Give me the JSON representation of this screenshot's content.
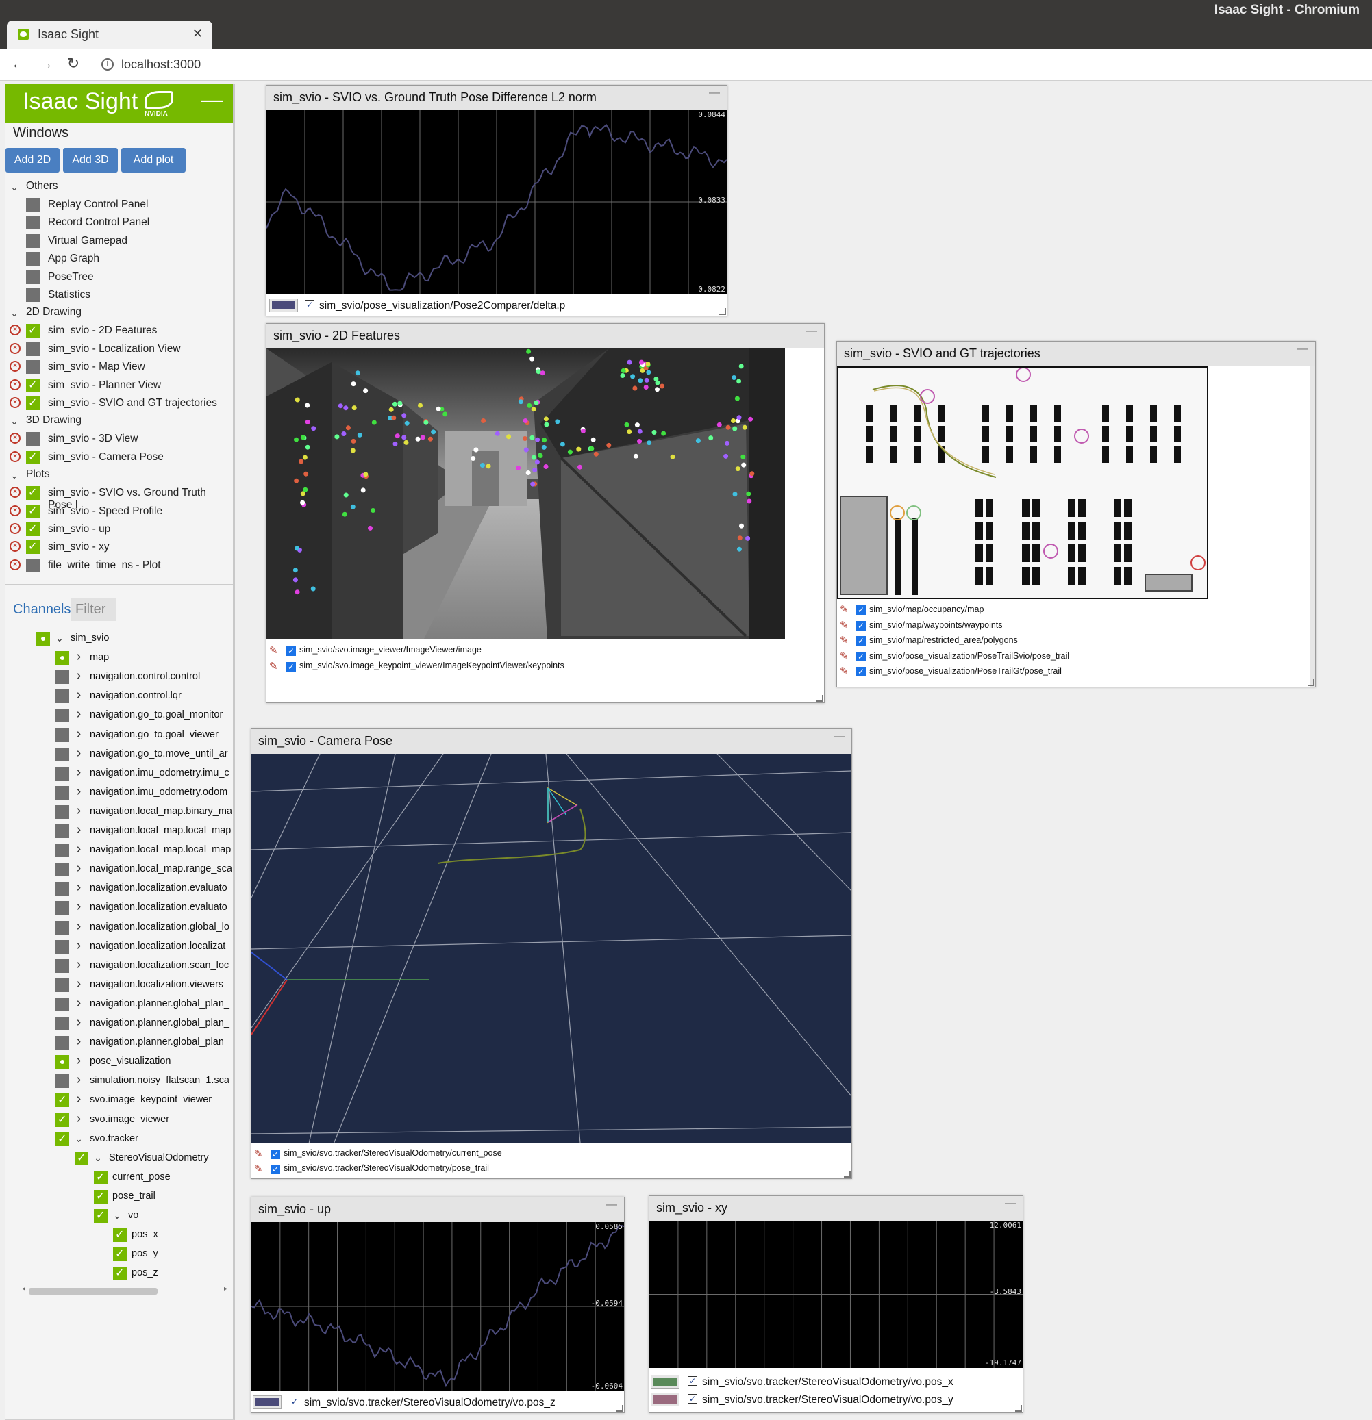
{
  "browser": {
    "window_title": "Isaac Sight - Chromium",
    "tab_title": "Isaac Sight",
    "url": "localhost:3000"
  },
  "sidebar": {
    "brand": "Isaac Sight",
    "nvidia": "NVIDIA",
    "windows_title": "Windows",
    "buttons": [
      "Add 2D",
      "Add 3D",
      "Add plot"
    ],
    "groups": [
      {
        "label": "Others",
        "items": [
          {
            "label": "Replay Control Panel",
            "checked": false,
            "removable": false
          },
          {
            "label": "Record Control Panel",
            "checked": false,
            "removable": false
          },
          {
            "label": "Virtual Gamepad",
            "checked": false,
            "removable": false
          },
          {
            "label": "App Graph",
            "checked": false,
            "removable": false
          },
          {
            "label": "PoseTree",
            "checked": false,
            "removable": false
          },
          {
            "label": "Statistics",
            "checked": false,
            "removable": false
          }
        ]
      },
      {
        "label": "2D Drawing",
        "items": [
          {
            "label": "sim_svio - 2D Features",
            "checked": true,
            "removable": true
          },
          {
            "label": "sim_svio - Localization View",
            "checked": false,
            "removable": true
          },
          {
            "label": "sim_svio - Map View",
            "checked": false,
            "removable": true
          },
          {
            "label": "sim_svio - Planner View",
            "checked": true,
            "removable": true
          },
          {
            "label": "sim_svio - SVIO and GT trajectories",
            "checked": true,
            "removable": true
          }
        ]
      },
      {
        "label": "3D Drawing",
        "items": [
          {
            "label": "sim_svio - 3D View",
            "checked": false,
            "removable": true
          },
          {
            "label": "sim_svio - Camera Pose",
            "checked": true,
            "removable": true
          }
        ]
      },
      {
        "label": "Plots",
        "items": [
          {
            "label": "sim_svio - SVIO vs. Ground Truth Pose I",
            "checked": true,
            "removable": true
          },
          {
            "label": "sim_svio - Speed Profile",
            "checked": true,
            "removable": true
          },
          {
            "label": "sim_svio - up",
            "checked": true,
            "removable": true
          },
          {
            "label": "sim_svio - xy",
            "checked": true,
            "removable": true
          },
          {
            "label": "file_write_time_ns - Plot",
            "checked": false,
            "removable": true
          }
        ]
      }
    ],
    "channels_title": "Channels",
    "filter_placeholder": "Filter",
    "channels": [
      {
        "label": "sim_svio",
        "depth": 0,
        "state": "partial",
        "expanded": true
      },
      {
        "label": "map",
        "depth": 1,
        "state": "partial",
        "expanded": false
      },
      {
        "label": "navigation.control.control",
        "depth": 1,
        "state": "off",
        "expanded": false
      },
      {
        "label": "navigation.control.lqr",
        "depth": 1,
        "state": "off",
        "expanded": false
      },
      {
        "label": "navigation.go_to.goal_monitor",
        "depth": 1,
        "state": "off",
        "expanded": false
      },
      {
        "label": "navigation.go_to.goal_viewer",
        "depth": 1,
        "state": "off",
        "expanded": false
      },
      {
        "label": "navigation.go_to.move_until_ar",
        "depth": 1,
        "state": "off",
        "expanded": false
      },
      {
        "label": "navigation.imu_odometry.imu_c",
        "depth": 1,
        "state": "off",
        "expanded": false
      },
      {
        "label": "navigation.imu_odometry.odom",
        "depth": 1,
        "state": "off",
        "expanded": false
      },
      {
        "label": "navigation.local_map.binary_ma",
        "depth": 1,
        "state": "off",
        "expanded": false
      },
      {
        "label": "navigation.local_map.local_map",
        "depth": 1,
        "state": "off",
        "expanded": false
      },
      {
        "label": "navigation.local_map.local_map",
        "depth": 1,
        "state": "off",
        "expanded": false
      },
      {
        "label": "navigation.local_map.range_sca",
        "depth": 1,
        "state": "off",
        "expanded": false
      },
      {
        "label": "navigation.localization.evaluato",
        "depth": 1,
        "state": "off",
        "expanded": false
      },
      {
        "label": "navigation.localization.evaluato",
        "depth": 1,
        "state": "off",
        "expanded": false
      },
      {
        "label": "navigation.localization.global_lo",
        "depth": 1,
        "state": "off",
        "expanded": false
      },
      {
        "label": "navigation.localization.localizat",
        "depth": 1,
        "state": "off",
        "expanded": false
      },
      {
        "label": "navigation.localization.scan_loc",
        "depth": 1,
        "state": "off",
        "expanded": false
      },
      {
        "label": "navigation.localization.viewers",
        "depth": 1,
        "state": "off",
        "expanded": false
      },
      {
        "label": "navigation.planner.global_plan_",
        "depth": 1,
        "state": "off",
        "expanded": false
      },
      {
        "label": "navigation.planner.global_plan_",
        "depth": 1,
        "state": "off",
        "expanded": false
      },
      {
        "label": "navigation.planner.global_plan",
        "depth": 1,
        "state": "off",
        "expanded": false
      },
      {
        "label": "pose_visualization",
        "depth": 1,
        "state": "partial",
        "expanded": false
      },
      {
        "label": "simulation.noisy_flatscan_1.sca",
        "depth": 1,
        "state": "off",
        "expanded": false
      },
      {
        "label": "svo.image_keypoint_viewer",
        "depth": 1,
        "state": "on",
        "expanded": false
      },
      {
        "label": "svo.image_viewer",
        "depth": 1,
        "state": "on",
        "expanded": false
      },
      {
        "label": "svo.tracker",
        "depth": 1,
        "state": "on",
        "expanded": true
      },
      {
        "label": "StereoVisualOdometry",
        "depth": 2,
        "state": "on",
        "expanded": true
      },
      {
        "label": "current_pose",
        "depth": 3,
        "state": "on",
        "leaf": true
      },
      {
        "label": "pose_trail",
        "depth": 3,
        "state": "on",
        "leaf": true
      },
      {
        "label": "vo",
        "depth": 3,
        "state": "on",
        "expanded": true
      },
      {
        "label": "pos_x",
        "depth": 4,
        "state": "on",
        "leaf": true
      },
      {
        "label": "pos_y",
        "depth": 4,
        "state": "on",
        "leaf": true
      },
      {
        "label": "pos_z",
        "depth": 4,
        "state": "on",
        "leaf": true
      }
    ]
  },
  "windows": {
    "pose_diff": {
      "title": "sim_svio - SVIO vs. Ground Truth Pose Difference L2 norm",
      "ticks": [
        "0.0844",
        "0.0833",
        "0.0822"
      ],
      "legend": [
        {
          "label": "sim_svio/pose_visualization/Pose2Comparer/delta.p",
          "color": "#4b4b7a"
        }
      ]
    },
    "features": {
      "title": "sim_svio - 2D Features",
      "legend": [
        "sim_svio/svo.image_viewer/ImageViewer/image",
        "sim_svio/svo.image_keypoint_viewer/ImageKeypointViewer/keypoints"
      ]
    },
    "trajectories": {
      "title": "sim_svio - SVIO and GT trajectories",
      "legend": [
        "sim_svio/map/occupancy/map",
        "sim_svio/map/waypoints/waypoints",
        "sim_svio/map/restricted_area/polygons",
        "sim_svio/pose_visualization/PoseTrailSvio/pose_trail",
        "sim_svio/pose_visualization/PoseTrailGt/pose_trail"
      ]
    },
    "camera_pose": {
      "title": "sim_svio - Camera Pose",
      "legend": [
        "sim_svio/svo.tracker/StereoVisualOdometry/current_pose",
        "sim_svio/svo.tracker/StereoVisualOdometry/pose_trail"
      ]
    },
    "up": {
      "title": "sim_svio - up",
      "ticks": [
        "0.0585",
        "-0.0594",
        "-0.0604"
      ],
      "legend": [
        {
          "label": "sim_svio/svo.tracker/StereoVisualOdometry/vo.pos_z",
          "color": "#4b4b7a"
        }
      ]
    },
    "xy": {
      "title": "sim_svio - xy",
      "ticks": [
        "12.0061",
        "-3.5843",
        "-19.1747"
      ],
      "legend": [
        {
          "label": "sim_svio/svo.tracker/StereoVisualOdometry/vo.pos_x",
          "color": "#5a8a5a"
        },
        {
          "label": "sim_svio/svo.tracker/StereoVisualOdometry/vo.pos_y",
          "color": "#9a6a7e"
        }
      ]
    }
  },
  "colors": {
    "nvidia_green": "#76b900",
    "button_blue": "#4a7fc1",
    "plot_line": "#4b4b7a",
    "scene_bg": "#1f2a45"
  }
}
